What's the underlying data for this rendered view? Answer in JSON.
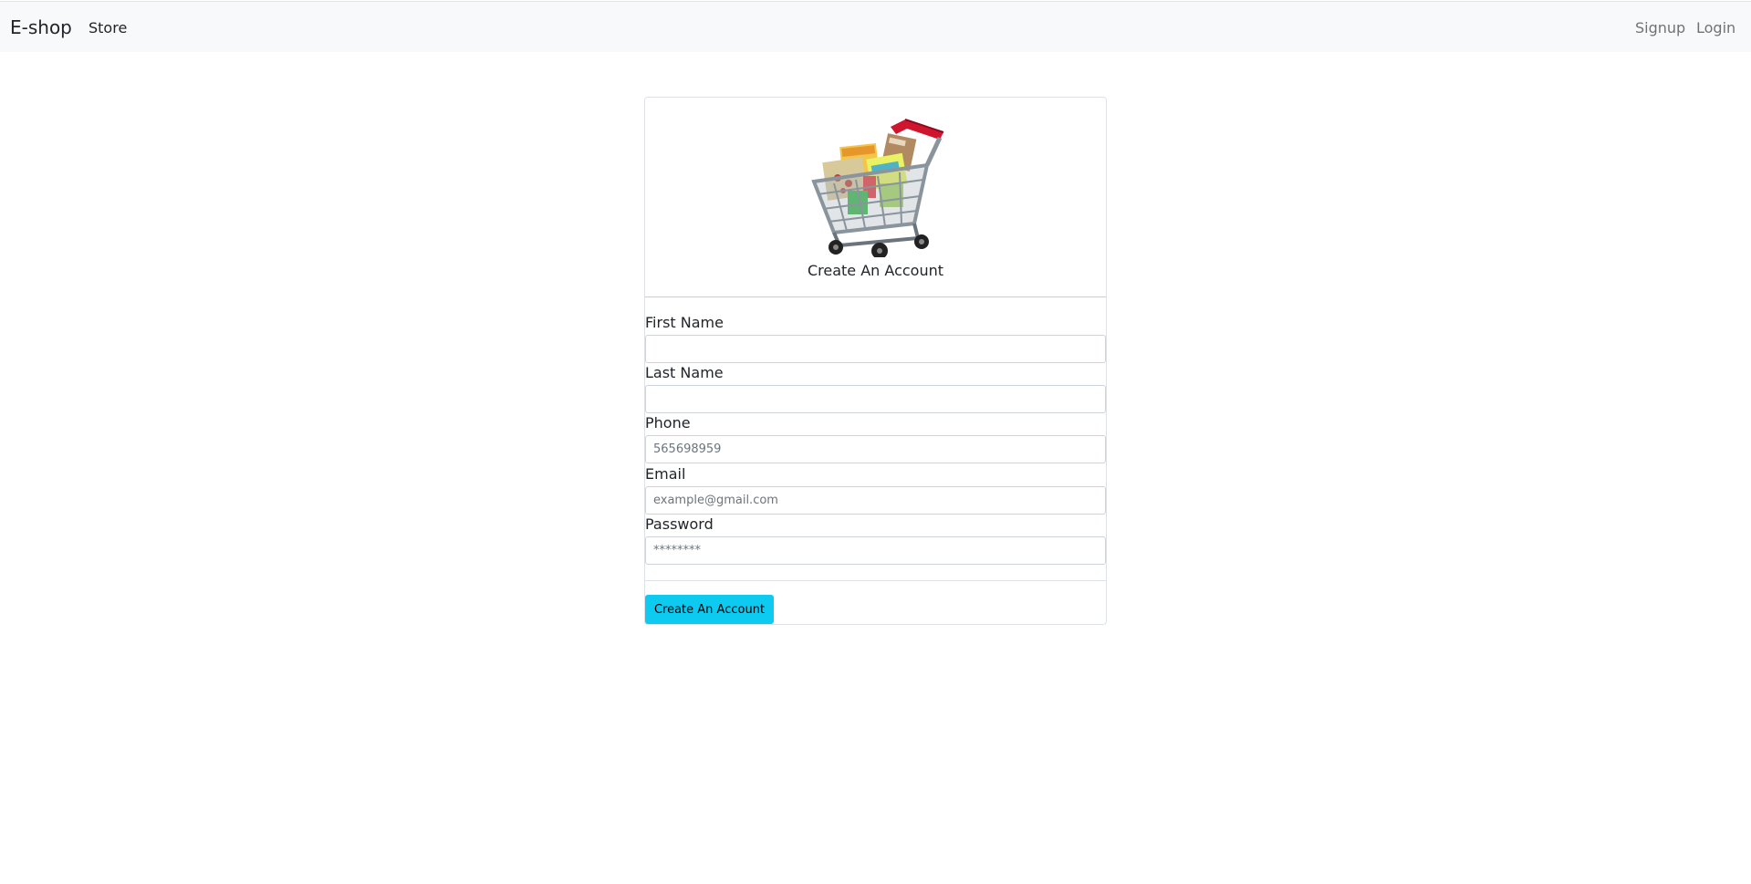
{
  "navbar": {
    "brand": "E-shop",
    "store_link": "Store",
    "signup_link": "Signup",
    "login_link": "Login"
  },
  "card": {
    "title": "Create An Account",
    "logo_icon": "shopping-cart-icon",
    "fields": [
      {
        "label": "First Name",
        "value": "",
        "placeholder": ""
      },
      {
        "label": "Last Name",
        "value": "",
        "placeholder": ""
      },
      {
        "label": "Phone",
        "value": "",
        "placeholder": "565698959"
      },
      {
        "label": "Email",
        "value": "",
        "placeholder": "example@gmail.com"
      },
      {
        "label": "Password",
        "value": "",
        "placeholder": "********"
      }
    ],
    "submit_label": "Create An Account"
  },
  "colors": {
    "navbar_bg": "#f8f9fa",
    "button_bg": "#0dcaf0"
  }
}
